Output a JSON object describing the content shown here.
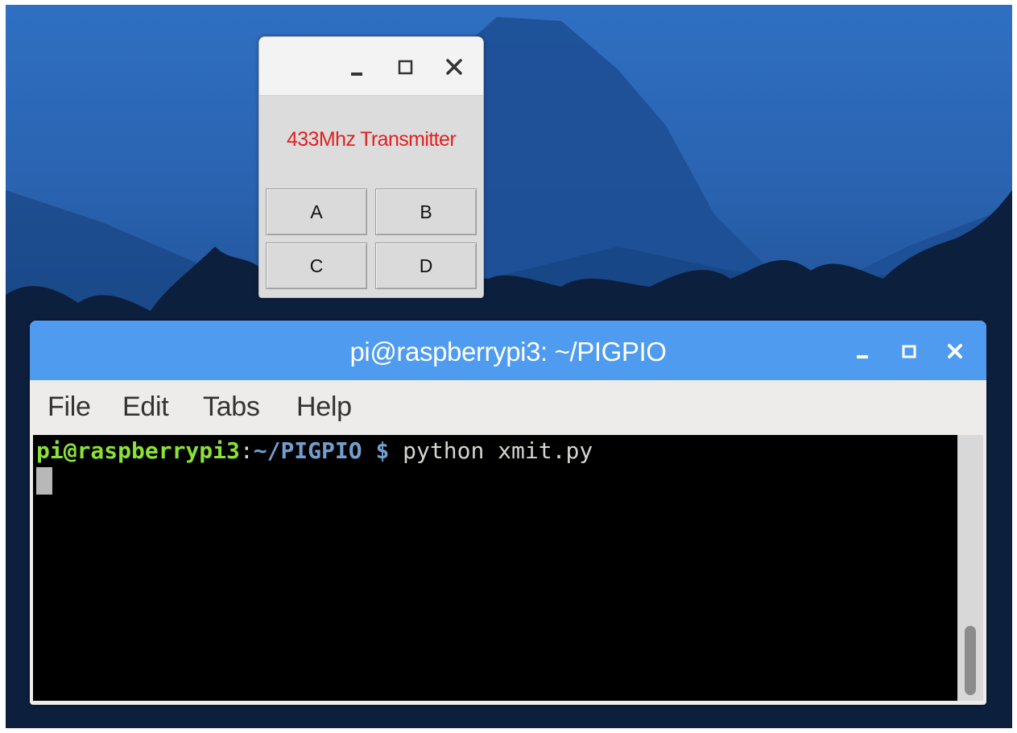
{
  "desktop": {
    "wallpaper": "mountain-forest",
    "colors": {
      "sky": "#2f6fc2",
      "mountain": "#1d4f95",
      "trees": "#0c1f3d"
    }
  },
  "tk_window": {
    "controls": {
      "minimize": "minimize-icon",
      "maximize": "maximize-icon",
      "close": "close-icon"
    },
    "label": "433Mhz Transmitter",
    "label_color": "#e32020",
    "buttons": [
      "A",
      "B",
      "C",
      "D"
    ]
  },
  "terminal": {
    "title": "pi@raspberrypi3: ~/PIGPIO",
    "titlebar_color": "#4e9bef",
    "controls": {
      "minimize": "minimize-icon",
      "maximize": "maximize-icon",
      "close": "close-icon"
    },
    "menu": [
      "File",
      "Edit",
      "Tabs",
      "Help"
    ],
    "prompt": {
      "user_host": "pi@raspberrypi3",
      "colon": ":",
      "path": "~/PIGPIO $",
      "command": " python xmit.py"
    },
    "colors": {
      "user": "#8ae234",
      "path": "#729fcf",
      "text": "#d3d7cf",
      "background": "#000000"
    }
  }
}
